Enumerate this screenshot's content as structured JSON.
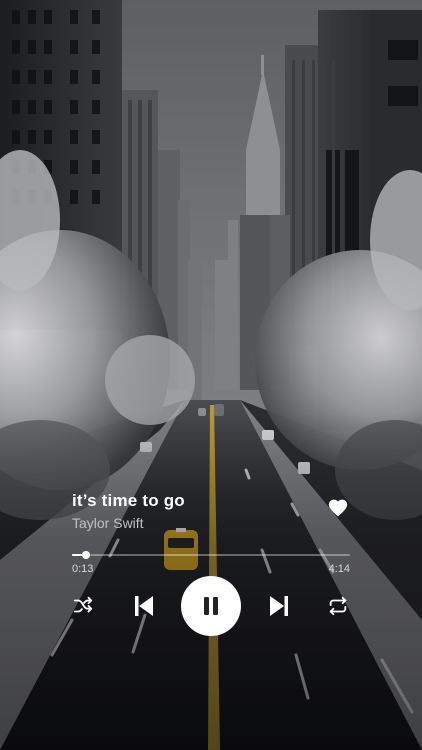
{
  "player": {
    "track_title": "it’s time to go",
    "artist": "Taylor Swift",
    "current_time": "0:13",
    "total_time": "4:14",
    "progress_fraction": 0.05,
    "liked": true
  },
  "controls": {
    "shuffle_icon": "shuffle-icon",
    "previous_icon": "skip-previous-icon",
    "play_pause_icon": "pause-icon",
    "next_icon": "skip-next-icon",
    "repeat_icon": "repeat-icon",
    "like_icon": "heart-icon"
  },
  "colors": {
    "foreground": "#ffffff",
    "muted_text": "#bfc0c2",
    "rail": "rgba(255,255,255,0.35)"
  },
  "background": {
    "description_icon": "city-street-background"
  }
}
